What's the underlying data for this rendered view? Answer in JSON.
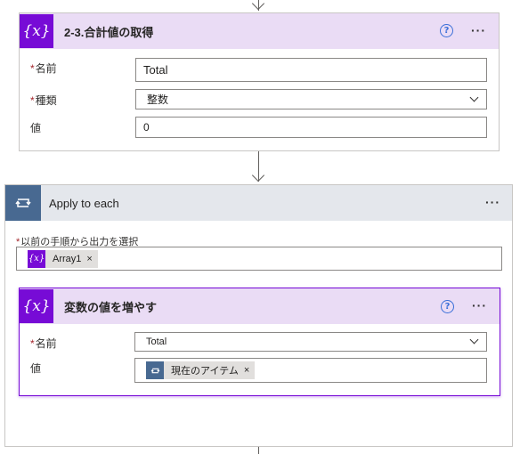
{
  "card1": {
    "icon": "{x}",
    "title": "2-3.合計値の取得",
    "help": "?",
    "more": "···",
    "fields": [
      {
        "label": "名前",
        "required": true,
        "value": "Total"
      },
      {
        "label": "種類",
        "required": true,
        "value": "整数"
      },
      {
        "label": "値",
        "required": false,
        "value": "0"
      }
    ]
  },
  "loop": {
    "title": "Apply to each",
    "more": "···",
    "select_label": "以前の手順から出力を選択",
    "select_token": "Array1",
    "token_icon": "{x}"
  },
  "card2": {
    "icon": "{x}",
    "title": "変数の値を増やす",
    "help": "?",
    "more": "···",
    "name_label": "名前",
    "name_value": "Total",
    "value_label": "値",
    "value_token": "現在のアイテム"
  },
  "req_mark": "*",
  "remove_mark": "×",
  "colors": {
    "variable_purple": "#770bd6",
    "loop_blue": "#486991",
    "header_lavender": "#eadcf5",
    "loop_header": "#e4e7ec"
  }
}
